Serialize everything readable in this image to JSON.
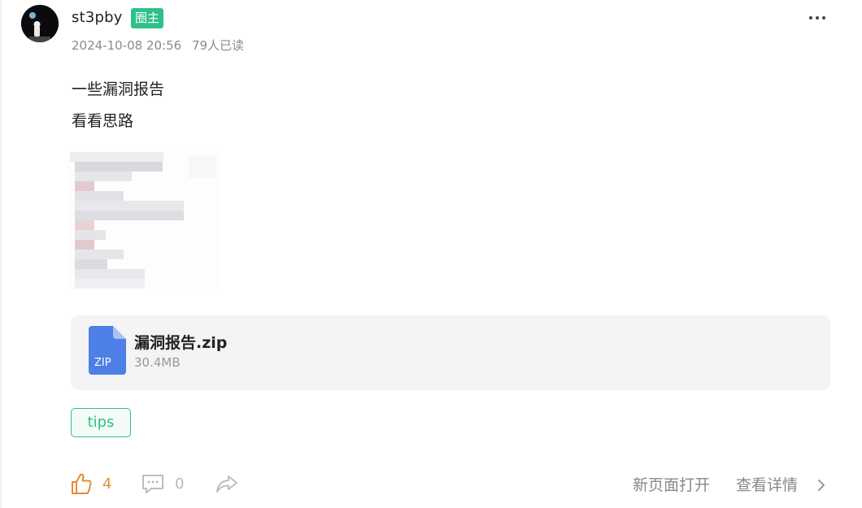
{
  "post": {
    "author": {
      "name": "st3pby",
      "badge": "圈主"
    },
    "timestamp": "2024-10-08 20:56",
    "read_count": "79人已读",
    "content_lines": [
      "一些漏洞报告",
      "看看思路"
    ],
    "attachment": {
      "file_name": "漏洞报告.zip",
      "file_size": "30.4MB",
      "file_type": "ZIP"
    },
    "tags": [
      "tips"
    ],
    "actions": {
      "like_count": "4",
      "comment_count": "0"
    },
    "links": {
      "open_new_page": "新页面打开",
      "view_details": "查看详情"
    }
  },
  "colors": {
    "accent_green": "#2fc08a",
    "like_orange": "#e58b35",
    "file_blue": "#4d7fe6"
  },
  "icons": {
    "more": "more-icon",
    "like": "thumbs-up-icon",
    "comment": "comment-icon",
    "share": "share-icon",
    "file": "zip-file-icon",
    "chevron": "chevron-right-icon"
  }
}
